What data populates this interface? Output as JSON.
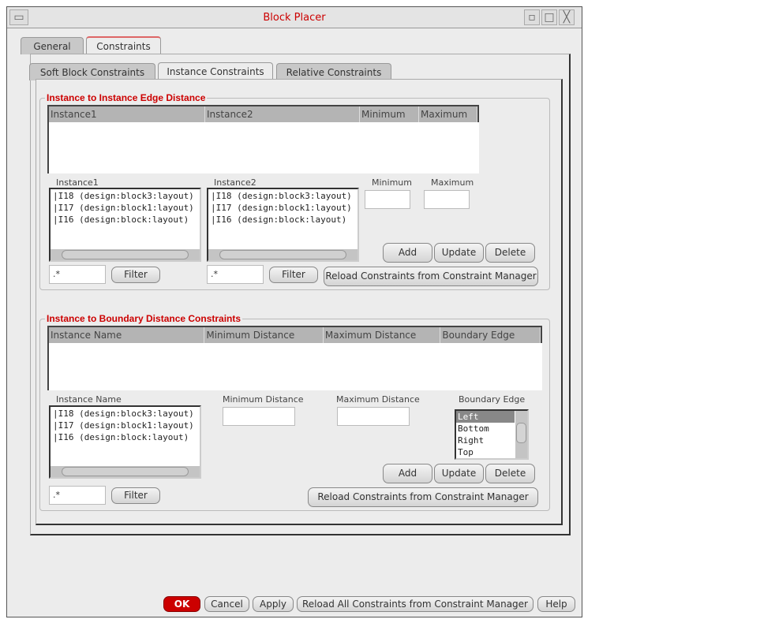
{
  "window": {
    "title": "Block Placer"
  },
  "tabs": [
    "General",
    "Constraints"
  ],
  "subtabs": [
    "Soft Block Constraints",
    "Instance Constraints",
    "Relative Constraints"
  ],
  "edge": {
    "title": "Instance to Instance Edge Distance",
    "columns": [
      "Instance1",
      "Instance2",
      "Minimum",
      "Maximum"
    ],
    "label_inst1": "Instance1",
    "label_inst2": "Instance2",
    "label_min": "Minimum",
    "label_max": "Maximum",
    "instances": [
      "|I18 (design:block3:layout)",
      "|I17 (design:block1:layout)",
      "|I16 (design:block:layout)"
    ],
    "filter1": ".*",
    "filter2": ".*",
    "filter_label": "Filter",
    "add": "Add",
    "update": "Update",
    "delete": "Delete",
    "reload": "Reload Constraints from Constraint Manager"
  },
  "boundary": {
    "title": "Instance to Boundary Distance Constraints",
    "columns": [
      "Instance Name",
      "Minimum Distance",
      "Maximum Distance",
      "Boundary Edge"
    ],
    "label_inst": "Instance Name",
    "label_min": "Minimum Distance",
    "label_max": "Maximum Distance",
    "label_edge": "Boundary Edge",
    "instances": [
      "|I18 (design:block3:layout)",
      "|I17 (design:block1:layout)",
      "|I16 (design:block:layout)"
    ],
    "edges": [
      "Left",
      "Bottom",
      "Right",
      "Top"
    ],
    "selected_edge": "Left",
    "filter": ".*",
    "filter_label": "Filter",
    "add": "Add",
    "update": "Update",
    "delete": "Delete",
    "reload": "Reload Constraints from Constraint Manager"
  },
  "footer": {
    "ok": "OK",
    "cancel": "Cancel",
    "apply": "Apply",
    "reload_all": "Reload All Constraints from Constraint Manager",
    "help": "Help",
    "ok_color": "#cc0000"
  }
}
